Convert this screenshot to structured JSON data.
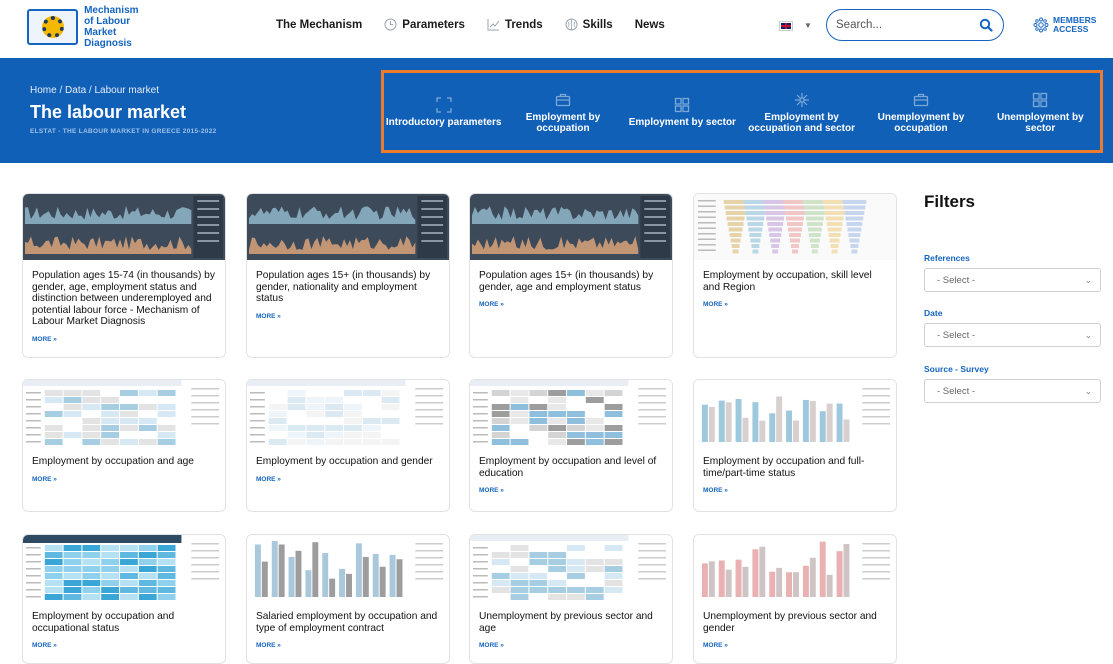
{
  "header": {
    "logo_text": [
      "Mechanism",
      "of Labour",
      "Market Diagnosis"
    ],
    "nav": [
      {
        "label": "The Mechanism",
        "icon": null
      },
      {
        "label": "Parameters",
        "icon": "clock-icon"
      },
      {
        "label": "Trends",
        "icon": "trend-icon"
      },
      {
        "label": "Skills",
        "icon": "brain-icon"
      },
      {
        "label": "News",
        "icon": null
      }
    ],
    "language": "EN",
    "search_placeholder": "Search...",
    "members_label": [
      "MEMBERS",
      "ACCESS"
    ]
  },
  "banner": {
    "breadcrumb": [
      "Home",
      "Data",
      "Labour market"
    ],
    "title": "The labour market",
    "subtitle": "ELSTAT - THE LABOUR MARKET IN GREECE 2015-2022",
    "categories": [
      {
        "label": "Introductory parameters",
        "icon": "expand-icon"
      },
      {
        "label": "Employment by occupation",
        "icon": "briefcase-icon"
      },
      {
        "label": "Employment by sector",
        "icon": "grid-icon"
      },
      {
        "label": "Employment by occupation and sector",
        "icon": "network-icon"
      },
      {
        "label": "Unemployment by occupation",
        "icon": "briefcase-icon"
      },
      {
        "label": "Unemployment by sector",
        "icon": "grid-icon"
      }
    ]
  },
  "cards": [
    {
      "title": "Population ages 15-74 (in thousands) by gender, age, employment status and distinction between underemployed and potential labour force - Mechanism of Labour Market Diagnosis",
      "more": "MORE »",
      "thumb": "dashboard-area"
    },
    {
      "title": "Population ages 15+ (in thousands) by gender, nationality and employment status",
      "more": "MORE »",
      "thumb": "dashboard-area"
    },
    {
      "title": "Population ages 15+ (in thousands) by gender, age and employment status",
      "more": "MORE »",
      "thumb": "dashboard-area"
    },
    {
      "title": "Employment by occupation, skill level and Region",
      "more": "MORE »",
      "thumb": "funnel"
    },
    {
      "title": "Employment by occupation and age",
      "more": "MORE »",
      "thumb": "table"
    },
    {
      "title": "Employment by occupation and gender",
      "more": "MORE »",
      "thumb": "table-light"
    },
    {
      "title": "Employment by occupation and level of education",
      "more": "MORE »",
      "thumb": "table-grey"
    },
    {
      "title": "Employment by occupation and full-time/part-time status",
      "more": "MORE »",
      "thumb": "bars"
    },
    {
      "title": "Employment by occupation and occupational status",
      "more": "MORE »",
      "thumb": "table-dark"
    },
    {
      "title": "Salaried employment by occupation and type of employment contract",
      "more": "MORE »",
      "thumb": "bars-grey"
    },
    {
      "title": "Unemployment by previous sector and age",
      "more": "MORE »",
      "thumb": "table"
    },
    {
      "title": "Unemployment by previous sector and gender",
      "more": "MORE »",
      "thumb": "bars-pink"
    }
  ],
  "filters": {
    "title": "Filters",
    "groups": [
      {
        "label": "References",
        "value": "- Select -"
      },
      {
        "label": "Date",
        "value": "- Select -"
      },
      {
        "label": "Source - Survey",
        "value": "- Select -"
      }
    ]
  },
  "colors": {
    "brand_blue": "#1160b8",
    "highlight_orange": "#ec7b2c",
    "link_blue": "#1565c0"
  }
}
